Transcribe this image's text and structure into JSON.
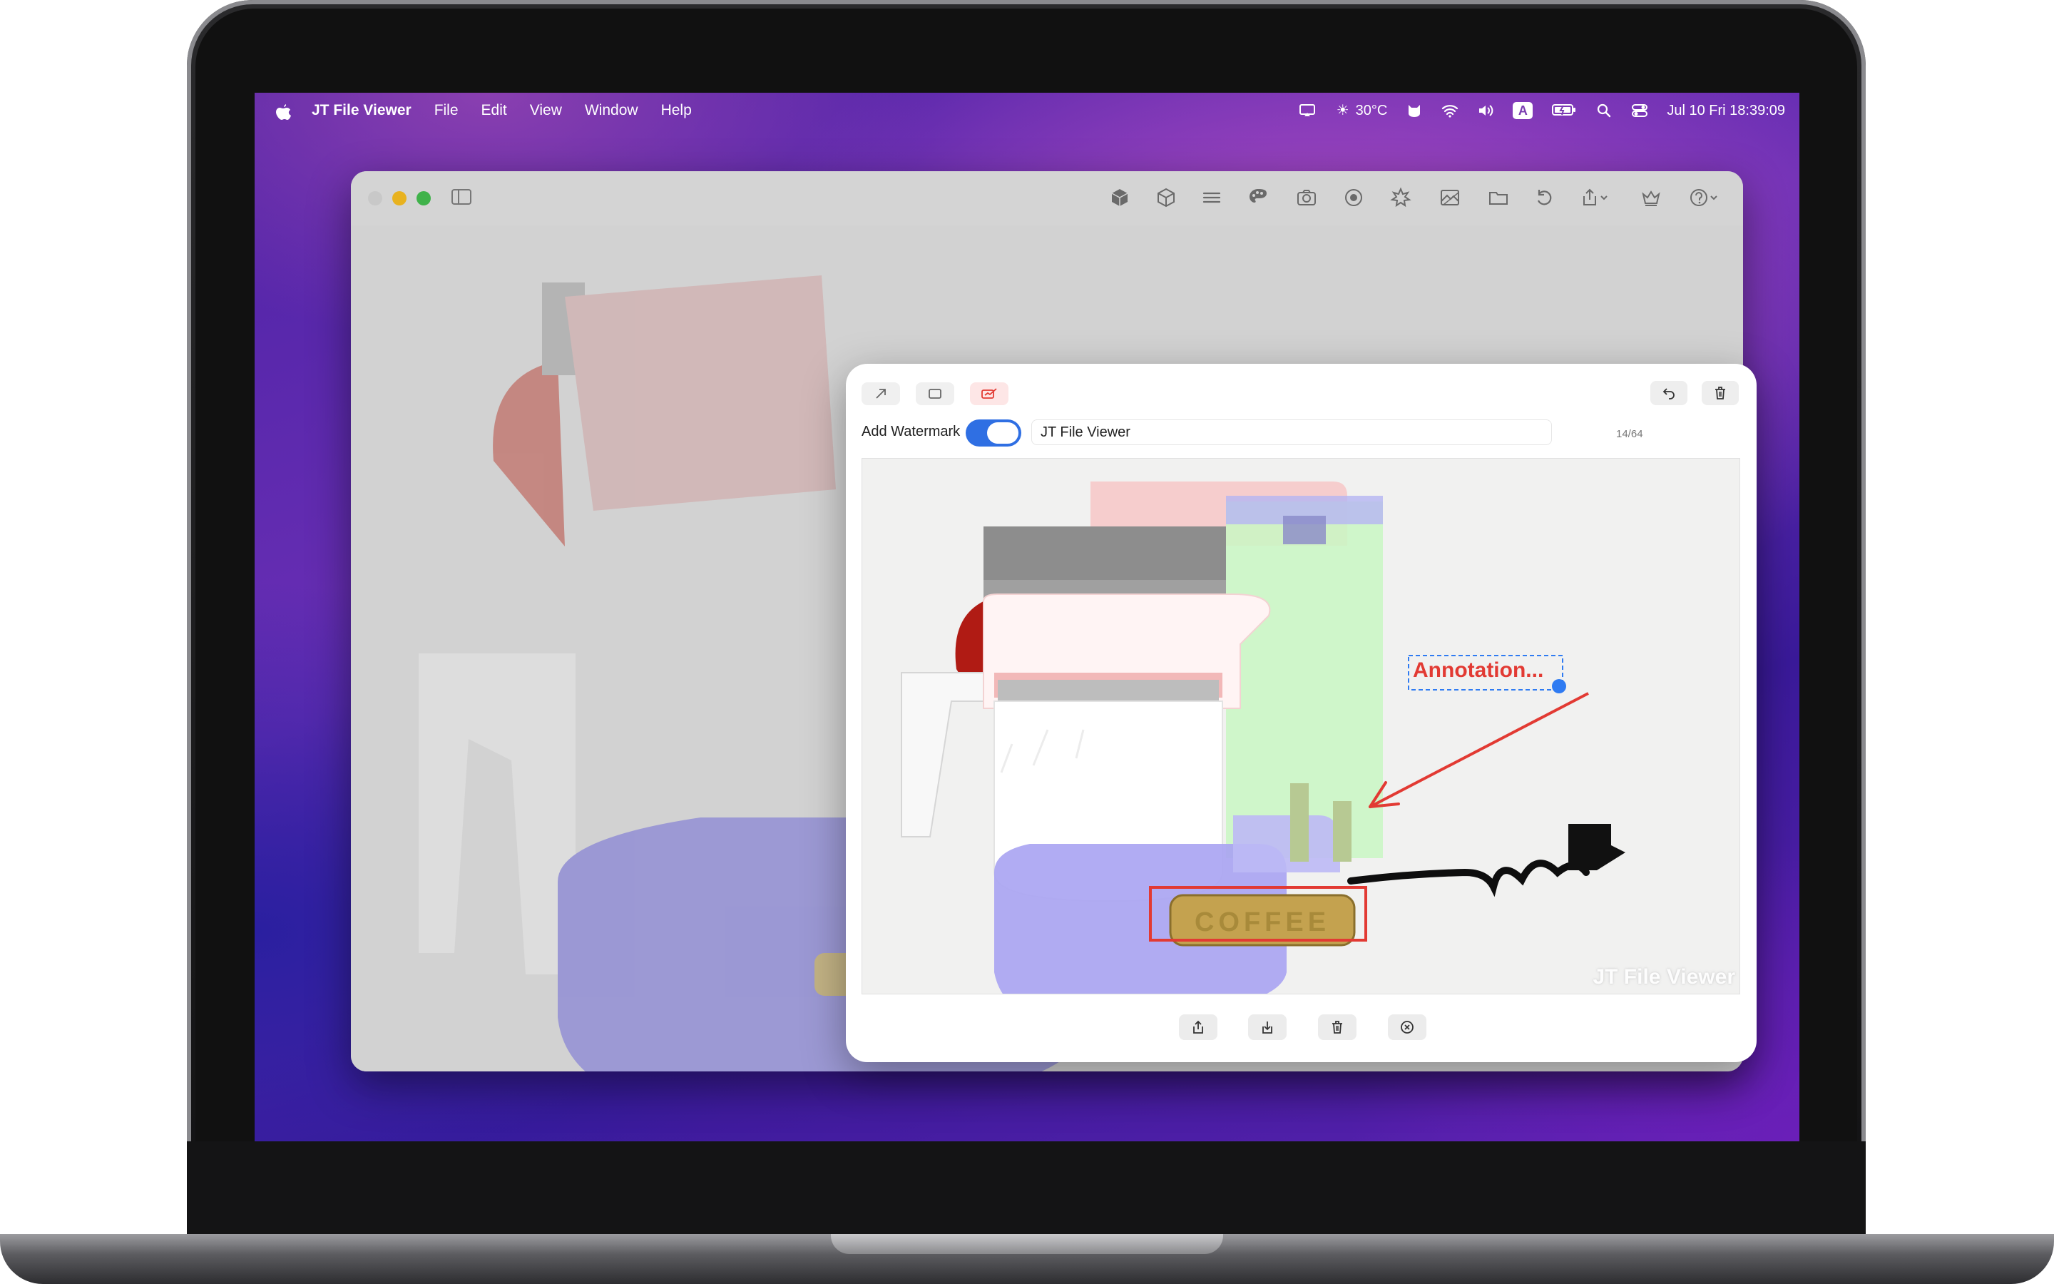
{
  "menubar": {
    "app_name": "JT File Viewer",
    "items": [
      "File",
      "Edit",
      "View",
      "Window",
      "Help"
    ],
    "weather": "30°C",
    "input_source": "A",
    "clock": "Jul 10 Fri  18:39:09"
  },
  "dialog": {
    "watermark_label": "Add Watermark",
    "watermark_enabled": true,
    "watermark_text": "JT File Viewer",
    "char_count": "14/64",
    "annotation_text": "Annotation...",
    "canvas_watermark": "JT File Viewer",
    "product_text": "COFFEE"
  },
  "colors": {
    "accent": "#2f6fe3",
    "annotation": "#e23a33",
    "selection_handle": "#2f7bf2"
  }
}
